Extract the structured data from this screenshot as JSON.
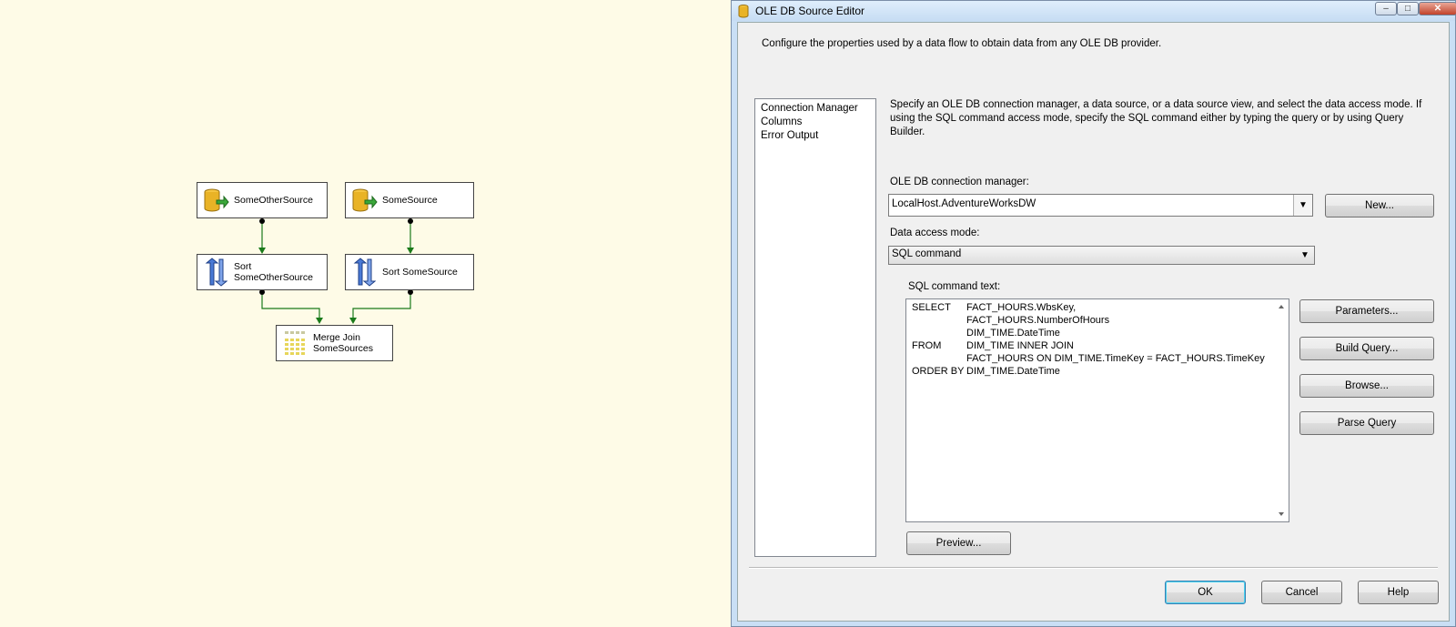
{
  "canvas": {
    "nodes": [
      {
        "label": "SomeOtherSource",
        "icon": "database-source-icon"
      },
      {
        "label": "SomeSource",
        "icon": "database-source-icon"
      },
      {
        "label": "Sort\nSomeOtherSource",
        "icon": "sort-icon"
      },
      {
        "label": "Sort SomeSource",
        "icon": "sort-icon"
      },
      {
        "label": "Merge Join\nSomeSources",
        "icon": "merge-join-icon"
      }
    ],
    "connector_color": "#1a7a1a"
  },
  "dialog": {
    "title": "OLE DB Source Editor",
    "header_text": "Configure the properties used by a data flow to obtain data from any OLE DB provider.",
    "nav_items": [
      "Connection Manager",
      "Columns",
      "Error Output"
    ],
    "description": "Specify an OLE DB connection manager, a data source, or a data source view, and select the data access mode. If using the SQL command access mode, specify the SQL command either by typing the query or by using Query Builder.",
    "connection_manager_label": "OLE DB connection manager:",
    "connection_manager_value": "LocalHost.AdventureWorksDW",
    "new_button": "New...",
    "data_access_mode_label": "Data access mode:",
    "data_access_mode_value": "SQL command",
    "sql_label": "SQL command text:",
    "sql_lines": [
      {
        "kw": "SELECT",
        "text": "FACT_HOURS.WbsKey,"
      },
      {
        "kw": "",
        "text": "FACT_HOURS.NumberOfHours"
      },
      {
        "kw": "",
        "text": "DIM_TIME.DateTime"
      },
      {
        "kw": "FROM",
        "text": "DIM_TIME INNER JOIN"
      },
      {
        "kw": "",
        "text": "FACT_HOURS ON DIM_TIME.TimeKey = FACT_HOURS.TimeKey"
      },
      {
        "kw": "ORDER BY",
        "text": "DIM_TIME.DateTime"
      }
    ],
    "buttons": {
      "parameters": "Parameters...",
      "build_query": "Build Query...",
      "browse": "Browse...",
      "parse_query": "Parse Query",
      "preview": "Preview...",
      "ok": "OK",
      "cancel": "Cancel",
      "help": "Help"
    }
  }
}
